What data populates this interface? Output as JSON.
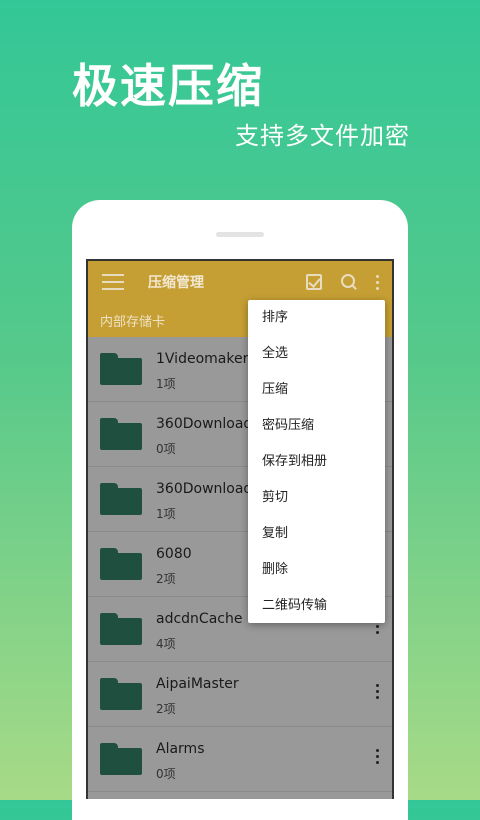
{
  "promo": {
    "headline": "极速压缩",
    "subline": "支持多文件加密"
  },
  "appbar": {
    "title": "压缩管理"
  },
  "path": {
    "label": "内部存储卡"
  },
  "files": [
    {
      "name": "1Videomaker",
      "count": "1项"
    },
    {
      "name": "360Download",
      "count": "0项"
    },
    {
      "name": "360DownloadCache",
      "count": "1项"
    },
    {
      "name": "6080",
      "count": "2项"
    },
    {
      "name": "adcdnCache",
      "count": "4项"
    },
    {
      "name": "AipaiMaster",
      "count": "2项"
    },
    {
      "name": "Alarms",
      "count": "0项"
    }
  ],
  "menu": {
    "items": [
      "排序",
      "全选",
      "压缩",
      "密码压缩",
      "保存到相册",
      "剪切",
      "复制",
      "删除",
      "二维码传输"
    ]
  }
}
